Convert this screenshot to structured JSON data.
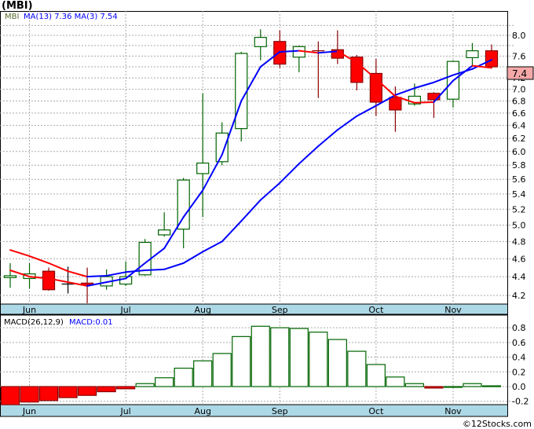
{
  "title": "(MBI)",
  "legend": {
    "symbol": "MBI",
    "ma13_label": "MA(13)",
    "ma13_value": "7.36",
    "ma3_label": "MA(3)",
    "ma3_value": "7.54"
  },
  "macd_legend": {
    "label": "MACD(26,12,9)",
    "value": "MACD:0.01"
  },
  "current_price_label": "7.4",
  "footer": "©12Stocks.com",
  "colors": {
    "up": "#006400",
    "down": "#ff0000",
    "down_border": "#8b0000",
    "ma": "#0000ff",
    "ma_alt": "#ff0000",
    "date_band": "#add8e6",
    "price_tag": "#f4a8a8"
  },
  "chart_data": [
    {
      "type": "candlestick",
      "y_scale": "log",
      "ylim": [
        4.1,
        8.3
      ],
      "y_ticks": [
        8.0,
        7.6,
        7.2,
        7.0,
        6.8,
        6.6,
        6.4,
        6.2,
        6.0,
        5.8,
        5.6,
        5.4,
        5.2,
        5.0,
        4.8,
        4.6,
        4.4,
        4.2
      ],
      "y_grid": [
        8.2,
        8.0,
        7.8,
        7.6,
        7.4,
        7.2,
        7.0,
        6.8,
        6.6,
        6.4,
        6.2,
        6.0,
        5.8,
        5.6,
        5.4,
        5.2,
        5.0,
        4.8,
        4.6,
        4.4,
        4.2
      ],
      "x_labels": [
        {
          "label": "Jun",
          "index": 1
        },
        {
          "label": "Jul",
          "index": 6
        },
        {
          "label": "Aug",
          "index": 10
        },
        {
          "label": "Sep",
          "index": 14
        },
        {
          "label": "Oct",
          "index": 19
        },
        {
          "label": "Nov",
          "index": 23
        }
      ],
      "grid": true,
      "candles": [
        {
          "o": 4.39,
          "h": 4.55,
          "l": 4.28,
          "c": 4.41
        },
        {
          "o": 4.38,
          "h": 4.55,
          "l": 4.27,
          "c": 4.43
        },
        {
          "o": 4.46,
          "h": 4.5,
          "l": 4.25,
          "c": 4.26
        },
        {
          "o": 4.32,
          "h": 4.51,
          "l": 4.22,
          "c": 4.32
        },
        {
          "o": 4.33,
          "h": 4.5,
          "l": 4.12,
          "c": 4.31
        },
        {
          "o": 4.3,
          "h": 4.48,
          "l": 4.26,
          "c": 4.4
        },
        {
          "o": 4.32,
          "h": 4.57,
          "l": 4.3,
          "c": 4.4
        },
        {
          "o": 4.42,
          "h": 4.83,
          "l": 4.41,
          "c": 4.79
        },
        {
          "o": 4.88,
          "h": 5.16,
          "l": 4.86,
          "c": 4.94
        },
        {
          "o": 4.95,
          "h": 5.62,
          "l": 4.72,
          "c": 5.59
        },
        {
          "o": 5.68,
          "h": 6.93,
          "l": 5.1,
          "c": 5.83
        },
        {
          "o": 5.85,
          "h": 6.45,
          "l": 5.8,
          "c": 6.28
        },
        {
          "o": 6.35,
          "h": 7.68,
          "l": 6.15,
          "c": 7.65
        },
        {
          "o": 7.78,
          "h": 8.12,
          "l": 7.52,
          "c": 7.96
        },
        {
          "o": 7.88,
          "h": 8.1,
          "l": 7.38,
          "c": 7.45
        },
        {
          "o": 7.58,
          "h": 7.8,
          "l": 7.3,
          "c": 7.78
        },
        {
          "o": 7.7,
          "h": 7.88,
          "l": 6.85,
          "c": 7.7
        },
        {
          "o": 7.72,
          "h": 8.1,
          "l": 7.45,
          "c": 7.56
        },
        {
          "o": 7.58,
          "h": 7.62,
          "l": 6.98,
          "c": 7.12
        },
        {
          "o": 7.28,
          "h": 7.55,
          "l": 6.55,
          "c": 6.78
        },
        {
          "o": 6.86,
          "h": 7.05,
          "l": 6.3,
          "c": 6.65
        },
        {
          "o": 6.75,
          "h": 7.1,
          "l": 6.72,
          "c": 6.88
        },
        {
          "o": 6.93,
          "h": 6.95,
          "l": 6.52,
          "c": 6.82
        },
        {
          "o": 6.83,
          "h": 7.52,
          "l": 6.69,
          "c": 7.5
        },
        {
          "o": 7.57,
          "h": 7.85,
          "l": 7.4,
          "c": 7.7
        },
        {
          "o": 7.7,
          "h": 7.82,
          "l": 7.4,
          "c": 7.4
        }
      ],
      "lines": [
        {
          "name": "MA(13)",
          "values": [
            4.7,
            4.63,
            4.55,
            4.46,
            4.4,
            4.41,
            4.45,
            4.47,
            4.48,
            4.55,
            4.68,
            4.8,
            5.05,
            5.32,
            5.55,
            5.82,
            6.08,
            6.33,
            6.55,
            6.72,
            6.9,
            7.02,
            7.12,
            7.25,
            7.36,
            7.53
          ],
          "segment_colors": [
            "#ff0000",
            "#ff0000",
            "#ff0000",
            "#ff0000",
            "#0000ff",
            "#0000ff",
            "#0000ff",
            "#0000ff",
            "#0000ff",
            "#0000ff",
            "#0000ff",
            "#0000ff",
            "#0000ff",
            "#0000ff",
            "#0000ff",
            "#0000ff",
            "#0000ff",
            "#0000ff",
            "#0000ff",
            "#0000ff",
            "#0000ff",
            "#0000ff",
            "#0000ff",
            "#0000ff",
            "#0000ff"
          ]
        },
        {
          "name": "MA(3)",
          "values": [
            4.47,
            4.4,
            4.38,
            4.34,
            4.3,
            4.34,
            4.38,
            4.55,
            4.72,
            5.1,
            5.45,
            5.95,
            6.8,
            7.4,
            7.68,
            7.7,
            7.66,
            7.69,
            7.48,
            7.18,
            6.88,
            6.77,
            6.78,
            7.15,
            7.42,
            7.38
          ],
          "segment_colors": [
            "#ff0000",
            "#ff0000",
            "#ff0000",
            "#ff0000",
            "#0000ff",
            "#0000ff",
            "#0000ff",
            "#0000ff",
            "#0000ff",
            "#0000ff",
            "#0000ff",
            "#0000ff",
            "#0000ff",
            "#0000ff",
            "#0000ff",
            "#ff0000",
            "#0000ff",
            "#ff0000",
            "#ff0000",
            "#ff0000",
            "#ff0000",
            "#ff0000",
            "#0000ff",
            "#0000ff",
            "#ff0000"
          ]
        }
      ]
    },
    {
      "type": "bar",
      "ylim": [
        -0.26,
        0.95
      ],
      "y_ticks": [
        0.8,
        0.6,
        0.4,
        0.2,
        0.0,
        -0.2
      ],
      "grid": true,
      "values": [
        -0.26,
        -0.21,
        -0.19,
        -0.15,
        -0.12,
        -0.07,
        -0.03,
        0.04,
        0.12,
        0.25,
        0.35,
        0.45,
        0.68,
        0.82,
        0.8,
        0.79,
        0.74,
        0.64,
        0.48,
        0.3,
        0.13,
        0.04,
        -0.02,
        0.0,
        0.04,
        0.01
      ]
    }
  ]
}
